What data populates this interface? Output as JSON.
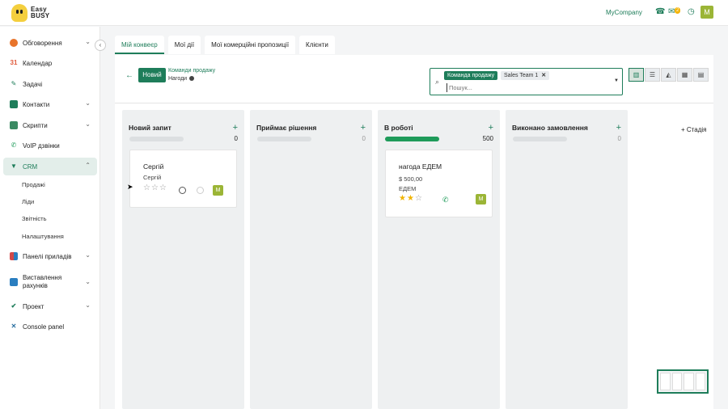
{
  "brand": {
    "line1": "Easy",
    "line2": "BUSY"
  },
  "header": {
    "company": "MyCompany",
    "chat_count": "2",
    "user_initial": "M"
  },
  "sidebar": {
    "items": [
      {
        "label": "Обговорення",
        "icon": "chat-bubble-icon",
        "color": "#e8742b"
      },
      {
        "label": "Календар",
        "icon": "calendar-icon",
        "color": "#e05a3b"
      },
      {
        "label": "Задачі",
        "icon": "pen-icon",
        "color": "#1e7d5a"
      },
      {
        "label": "Контакти",
        "icon": "contacts-icon",
        "color": "#1e7d5a"
      },
      {
        "label": "Скрипти",
        "icon": "scripts-icon",
        "color": "#3a8a62"
      },
      {
        "label": "VoIP дзвінки",
        "icon": "phone-icon",
        "color": "#1e9b5a"
      },
      {
        "label": "CRM",
        "icon": "crm-icon",
        "color": "#1e7d5a"
      },
      {
        "label": "Панелі приладів",
        "icon": "dashboard-icon",
        "color": "#d24a4a"
      },
      {
        "label": "Виставлення рахунків",
        "icon": "invoice-icon",
        "color": "#2a7ec0"
      },
      {
        "label": "Проект",
        "icon": "checkmark-icon",
        "color": "#1e7d5a"
      },
      {
        "label": "Console panel",
        "icon": "tools-icon",
        "color": "#2a6fa0"
      }
    ],
    "crm_sub": [
      "Продажі",
      "Ліди",
      "Звітність",
      "Налаштування"
    ]
  },
  "tabs": [
    "Мій конвеєр",
    "Мої дії",
    "Мої комерційні пропозиції",
    "Клієнти"
  ],
  "toolbar": {
    "new_label": "Новий",
    "breadcrumb_team": "Команди продажу",
    "breadcrumb_sub": "Нагоди",
    "facet_label": "Команда продажу",
    "facet_value": "Sales Team 1",
    "search_placeholder": "Пошук..."
  },
  "columns": [
    {
      "title": "Новий запит",
      "count": "0",
      "progress": 0
    },
    {
      "title": "Приймає рішення",
      "count": "0",
      "progress": 0
    },
    {
      "title": "В роботі",
      "count": "500",
      "progress": 1.0
    },
    {
      "title": "Виконано замовлення",
      "count": "0",
      "progress": 0
    }
  ],
  "cards": [
    {
      "title": "Сергій",
      "line1": "Сергій",
      "stars": 0,
      "avatar": "M"
    },
    {
      "title": "нагода ЕДЕМ",
      "amount": "$ 500,00",
      "line2": "ЕДЕМ",
      "stars": 2,
      "avatar": "M"
    }
  ],
  "add_stage_label": "Стадія",
  "colors": {
    "accent": "#1e7d5a",
    "progress": "#1e9b5a",
    "avatar": "#9bb536",
    "star": "#f0b400"
  }
}
